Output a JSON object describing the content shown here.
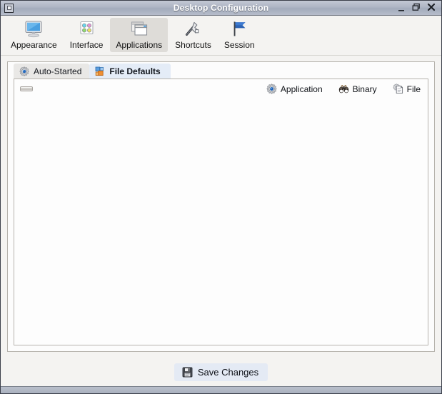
{
  "window": {
    "title": "Desktop Configuration",
    "menu_icon": "window-menu-icon",
    "minimize_label": "–",
    "maximize_label": "❐",
    "close_label": "✕"
  },
  "toolbar": {
    "items": [
      {
        "label": "Appearance",
        "icon": "monitor-icon",
        "active": false
      },
      {
        "label": "Interface",
        "icon": "color-swatch-icon",
        "active": false
      },
      {
        "label": "Applications",
        "icon": "windows-icon",
        "active": true
      },
      {
        "label": "Shortcuts",
        "icon": "wrench-icon",
        "active": false
      },
      {
        "label": "Session",
        "icon": "flag-icon",
        "active": false
      }
    ]
  },
  "tabs": [
    {
      "label": "Auto-Started",
      "icon": "gear-icon",
      "active": false
    },
    {
      "label": "File Defaults",
      "icon": "file-types-icon",
      "active": true
    }
  ],
  "content": {
    "grip": "drag-handle",
    "actions": [
      {
        "label": "Application",
        "icon": "gear-icon"
      },
      {
        "label": "Binary",
        "icon": "binoculars-icon"
      },
      {
        "label": "File",
        "icon": "document-gear-icon"
      }
    ],
    "rows": []
  },
  "footer": {
    "save_label": "Save Changes",
    "save_icon": "floppy-disk-icon"
  },
  "colors": {
    "titlebar": "#aeb5c4",
    "active_tab": "#e4ecf7",
    "inactive_tab": "#e9e8e6",
    "toolbar_active": "#dedcd8",
    "panel_bg": "#f4f3f1",
    "content_bg": "#fdfdfd",
    "save_button": "#e4eaf4"
  }
}
